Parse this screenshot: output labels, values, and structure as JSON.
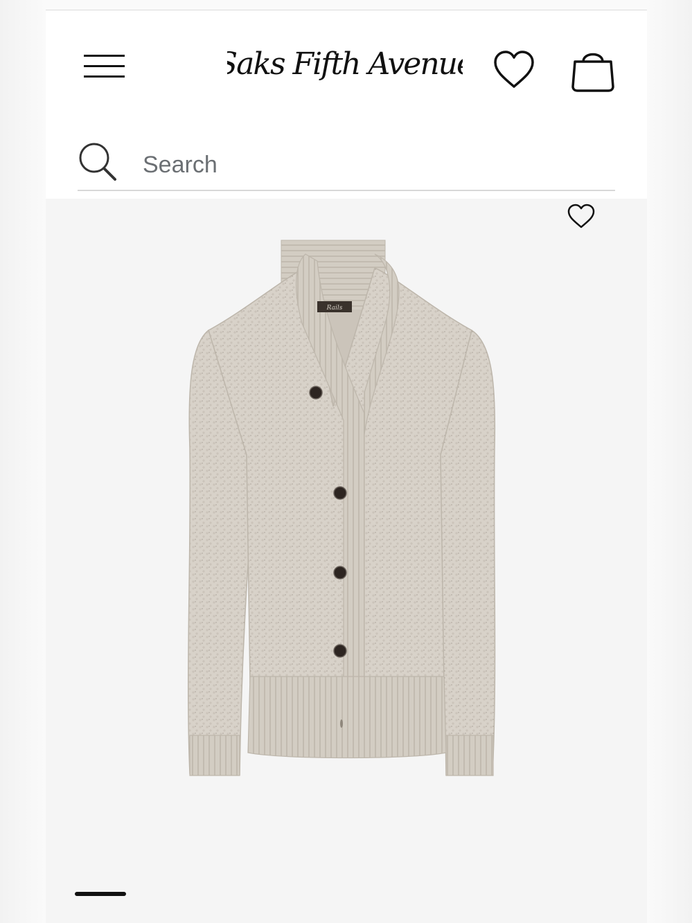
{
  "header": {
    "brand_name": "Saks Fifth Avenue"
  },
  "search": {
    "placeholder": "Search",
    "value": ""
  },
  "icons": {
    "menu": "hamburger-menu-icon",
    "wishlist": "heart-outline-icon",
    "bag": "shopping-bag-icon",
    "search": "magnifier-icon",
    "product_wishlist": "heart-outline-icon"
  },
  "product": {
    "label_text": "Rails"
  },
  "colors": {
    "header_bg": "#ffffff",
    "page_bg": "#f5f5f5",
    "icon": "#111111",
    "placeholder_text": "#6b6f73",
    "sweater": "#d6d0c7"
  }
}
